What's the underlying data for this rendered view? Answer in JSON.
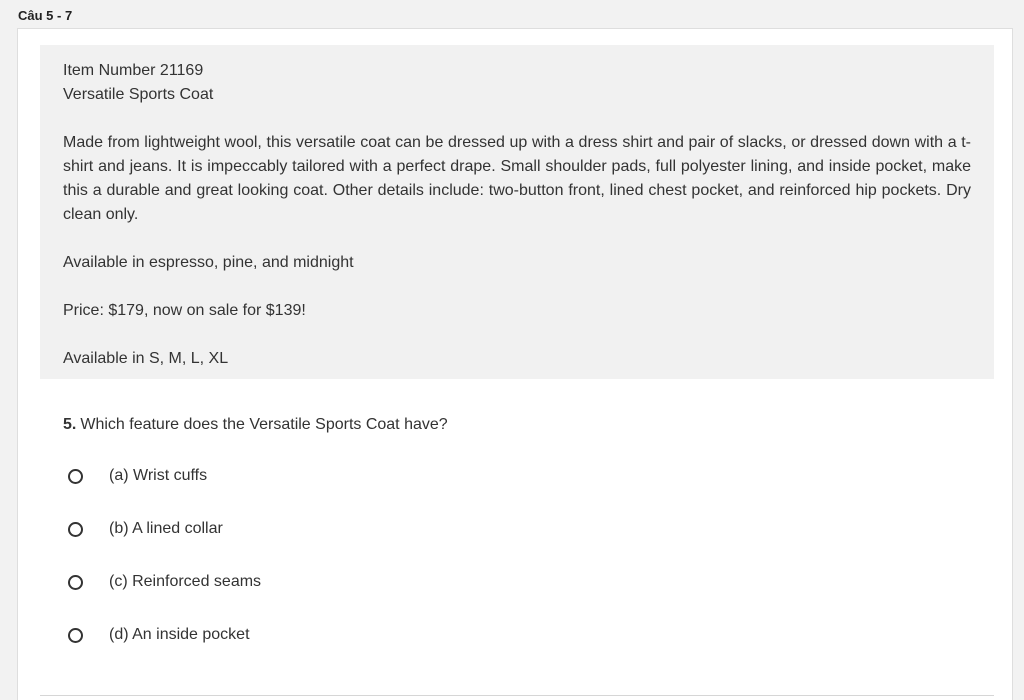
{
  "section": {
    "title": "Câu 5 - 7"
  },
  "passage": {
    "item_number": "Item Number 21169",
    "product_name": "Versatile Sports Coat",
    "description": "Made from lightweight wool, this versatile coat can be dressed up with a dress shirt and pair of slacks, or dressed down with a t-shirt and jeans. It is impeccably tailored with a perfect drape. Small shoulder pads, full polyester lining, and inside pocket, make this a durable and great looking coat. Other details include: two-button front, lined chest pocket, and reinforced hip pockets. Dry clean only.",
    "colors": "Available in espresso, pine, and midnight",
    "price": "Price: $179, now on sale for $139!",
    "sizes": "Available in S, M, L, XL"
  },
  "question": {
    "number": "5.",
    "text": "Which feature does the Versatile Sports Coat have?",
    "options": [
      {
        "label": "(a) Wrist cuffs"
      },
      {
        "label": "(b) A lined collar"
      },
      {
        "label": "(c) Reinforced seams"
      },
      {
        "label": "(d) An inside pocket"
      }
    ]
  }
}
